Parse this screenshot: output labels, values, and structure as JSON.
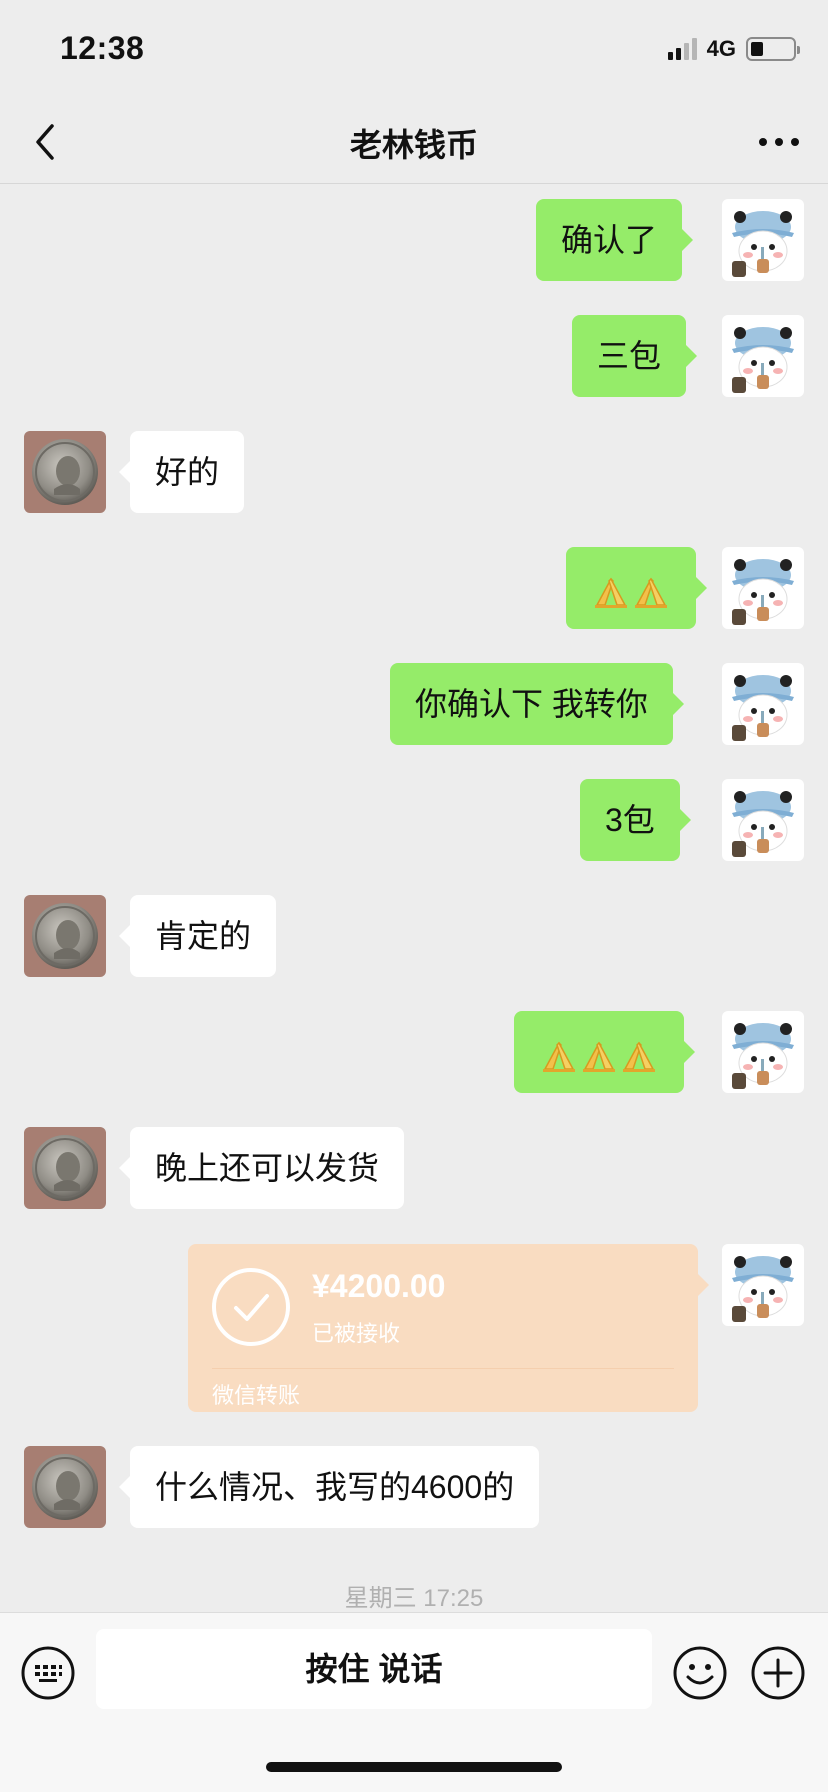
{
  "status_bar": {
    "time": "12:38",
    "network": "4G"
  },
  "nav": {
    "title": "老林钱币"
  },
  "messages": [
    {
      "side": "out",
      "text": "确认了"
    },
    {
      "side": "out",
      "text": "三包"
    },
    {
      "side": "in",
      "text": "好的"
    },
    {
      "side": "out",
      "emoji": "folded-hands-icon",
      "count": 2
    },
    {
      "side": "out",
      "text": "你确认下 我转你"
    },
    {
      "side": "out",
      "text": "3包"
    },
    {
      "side": "in",
      "text": "肯定的"
    },
    {
      "side": "out",
      "emoji": "folded-hands-icon",
      "count": 3
    },
    {
      "side": "in",
      "text": "晚上还可以发货"
    },
    {
      "side": "out",
      "type": "transfer"
    },
    {
      "side": "in",
      "text": "什么情况、我写的4600的"
    }
  ],
  "transfer": {
    "amount": "¥4200.00",
    "status": "已被接收",
    "footer": "微信转账"
  },
  "timestamp": "星期三 17:25",
  "input": {
    "hold_to_talk": "按住 说话"
  },
  "colors": {
    "outgoing_bubble": "#95ec69",
    "incoming_bubble": "#ffffff",
    "transfer_card": "#f9dcc1",
    "background": "#ededed"
  }
}
